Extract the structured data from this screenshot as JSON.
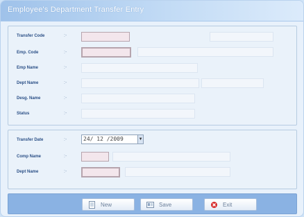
{
  "window": {
    "title": "Employee's Department Transfer Entry"
  },
  "top_section": {
    "labels": [
      "Transfer Code",
      "Emp. Code",
      "Emp Name",
      "Dept Name",
      "Desg. Name",
      "Status"
    ],
    "colon": ":-",
    "values": {
      "transfer_code": "",
      "emp_code": "",
      "emp_name": "",
      "dept_name": "",
      "desg_name": "",
      "status": ""
    }
  },
  "bottom_section": {
    "labels": [
      "Transfer Date",
      "Comp Name",
      "Dept Name"
    ],
    "colon": ":-",
    "transfer_date": "24/ 12 /2009"
  },
  "footer": {
    "new_label": "New",
    "save_label": "Save",
    "exit_label": "Exit"
  },
  "colors": {
    "title_gradient_start": "#9fc2ea",
    "panel_bg": "#e8f1fb",
    "label_color": "#2a4f86",
    "key_field_bg": "#f3e6ec",
    "footer_bg": "#8ab2e3",
    "exit_icon": "#d62828"
  },
  "icons": {
    "new": "new-document-icon",
    "save": "save-document-icon",
    "exit": "exit-icon",
    "combo": "calendar-dropdown-icon"
  }
}
